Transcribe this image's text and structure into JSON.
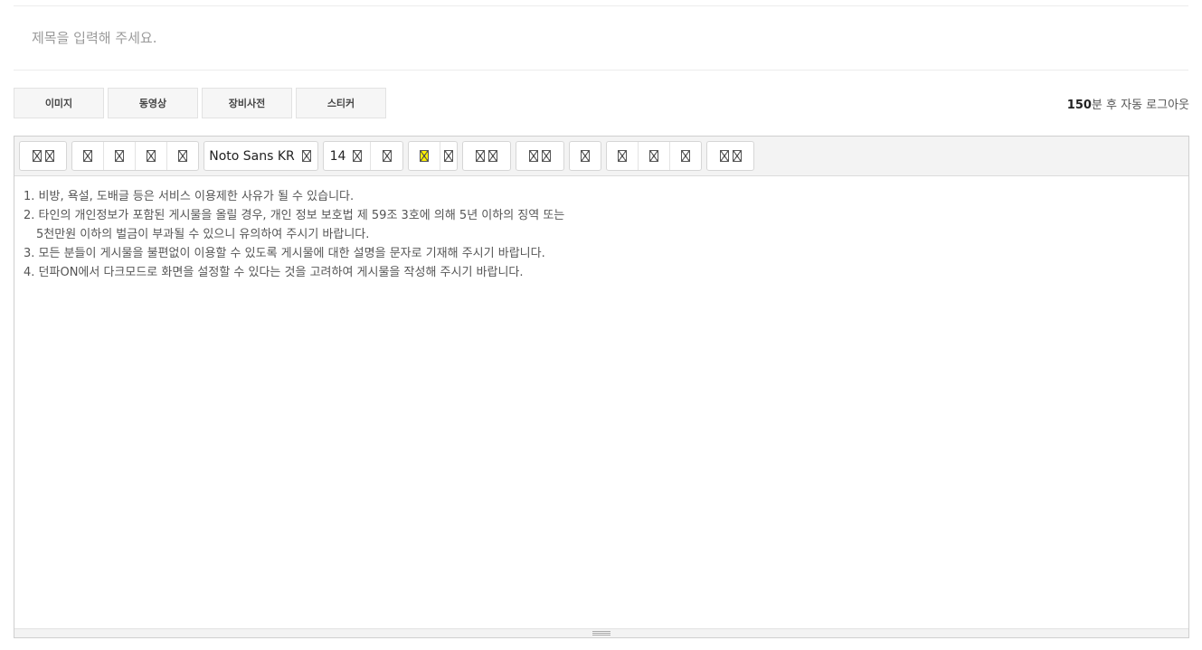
{
  "title_field": {
    "placeholder": "제목을 입력해 주세요.",
    "value": ""
  },
  "attachments": {
    "image_label": "이미지",
    "video_label": "동영상",
    "equipment_label": "장비사전",
    "sticker_label": "스티커"
  },
  "logout": {
    "minutes": "150",
    "suffix": "분 후 자동 로그아웃"
  },
  "toolbar": {
    "font_family": "Noto Sans KR",
    "font_size": "14",
    "icons": [
      "broken-image-icon"
    ]
  },
  "content": {
    "lines": [
      "1. 비방, 욕설, 도배글 등은 서비스 이용제한 사유가 될 수 있습니다.",
      "2. 타인의 개인정보가 포함된 게시물을 올릴 경우, 개인 정보 보호법 제 59조 3호에 의해 5년 이하의 징역 또는",
      "5천만원 이하의 벌금이 부과될 수 있으니 유의하여 주시기 바랍니다.",
      "3. 모든 분들이 게시물을 불편없이 이용할 수 있도록 게시물에 대한 설명을 문자로 기재해 주시기 바랍니다.",
      "4. 던파ON에서 다크모드로 화면을 설정할 수 있다는 것을 고려하여 게시물을 작성해 주시기 바랍니다."
    ]
  },
  "colors": {
    "highlight": "#fff200",
    "border": "#cfcfcf",
    "toolbar_bg": "#f3f3f3"
  }
}
